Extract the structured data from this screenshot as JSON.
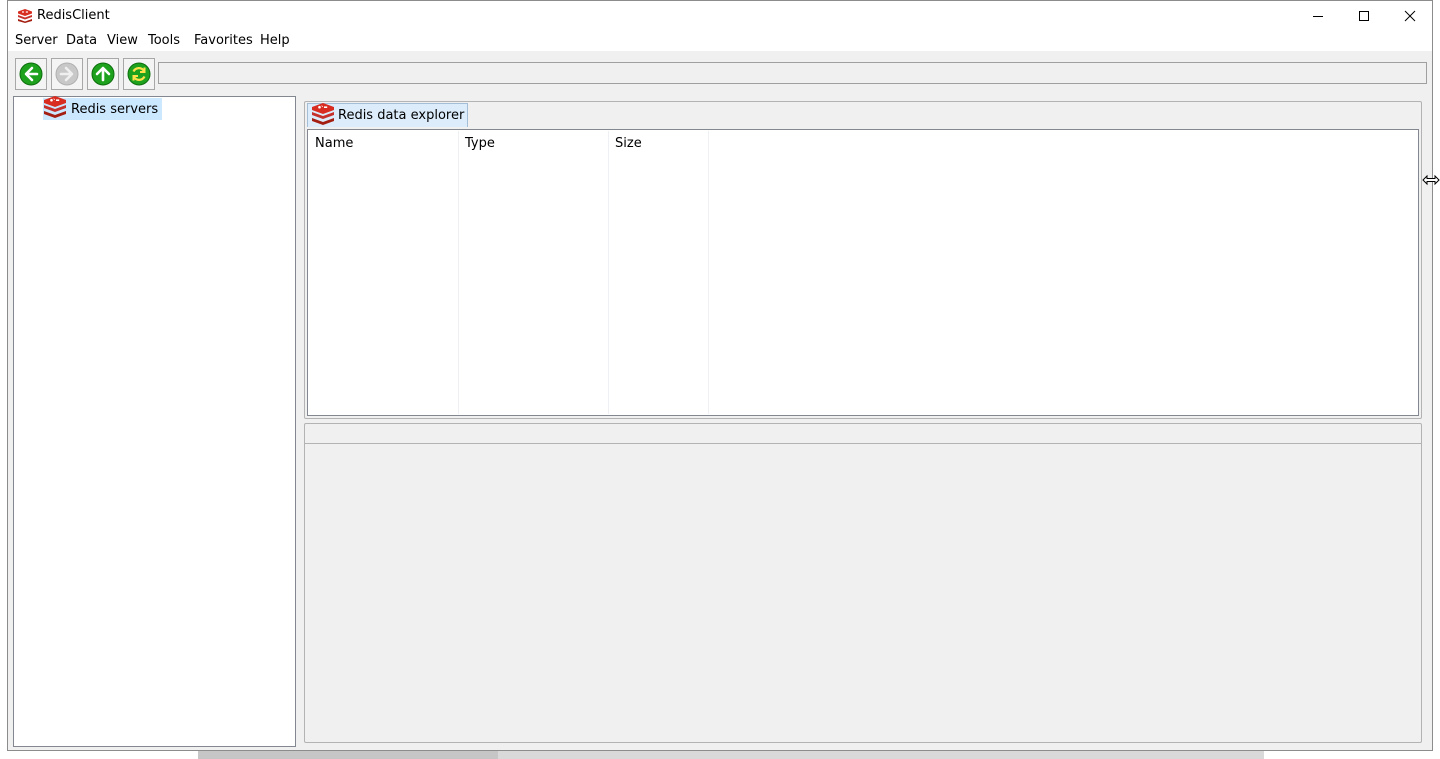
{
  "window": {
    "title": "RedisClient"
  },
  "menu": {
    "items": [
      "Server",
      "Data",
      "View",
      "Tools",
      "Favorites",
      "Help"
    ]
  },
  "toolbar": {
    "buttons": [
      {
        "icon": "back-arrow-icon",
        "enabled": true
      },
      {
        "icon": "forward-arrow-icon",
        "enabled": false
      },
      {
        "icon": "up-arrow-icon",
        "enabled": true
      },
      {
        "icon": "refresh-icon",
        "enabled": true
      }
    ],
    "address_value": ""
  },
  "tree": {
    "root_label": "Redis servers",
    "root_icon": "redis-icon"
  },
  "explorer": {
    "tab_label": "Redis data explorer",
    "tab_icon": "redis-icon",
    "columns": [
      "Name",
      "Type",
      "Size"
    ],
    "rows": []
  },
  "colors": {
    "redis_red": "#d82c20",
    "selection": "#cce8ff",
    "green_button": "#1ea21e",
    "tab_background": "#dcecfb"
  }
}
